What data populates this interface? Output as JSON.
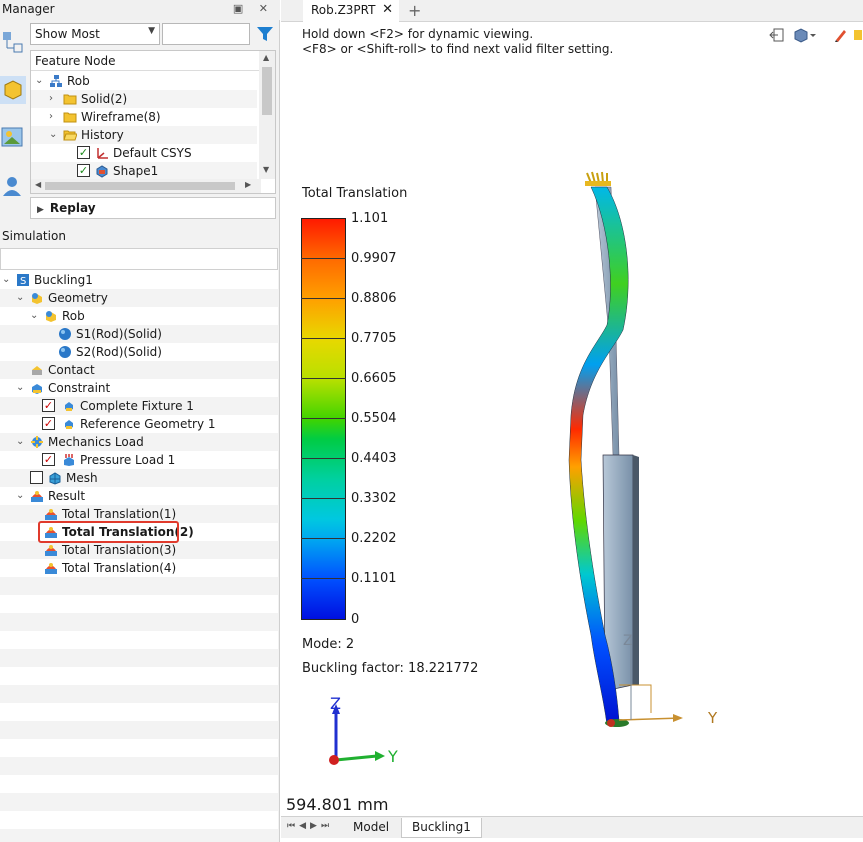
{
  "manager": {
    "title": "Manager",
    "show_filter": "Show Most",
    "filter_input": "",
    "tree_header": "Feature Node",
    "tree_items": [
      {
        "label": "Rob",
        "level": 0
      },
      {
        "label": "Solid(2)",
        "level": 1
      },
      {
        "label": "Wireframe(8)",
        "level": 1
      },
      {
        "label": "History",
        "level": 1
      },
      {
        "label": "Default CSYS",
        "level": 2
      },
      {
        "label": "Shape1",
        "level": 2
      }
    ],
    "replay": "Replay"
  },
  "simulation": {
    "title": "Simulation",
    "items": [
      {
        "label": "Buckling1"
      },
      {
        "label": "Geometry"
      },
      {
        "label": "Rob"
      },
      {
        "label": "S1(Rod)(Solid)"
      },
      {
        "label": "S2(Rod)(Solid)"
      },
      {
        "label": "Contact"
      },
      {
        "label": "Constraint"
      },
      {
        "label": "Complete Fixture 1"
      },
      {
        "label": "Reference Geometry 1"
      },
      {
        "label": "Mechanics Load"
      },
      {
        "label": "Pressure Load 1"
      },
      {
        "label": "Mesh"
      },
      {
        "label": "Result"
      },
      {
        "label": "Total Translation(1)"
      },
      {
        "label": "Total Translation(2)"
      },
      {
        "label": "Total Translation(3)"
      },
      {
        "label": "Total Translation(4)"
      }
    ]
  },
  "document": {
    "tab": "Rob.Z3PRT",
    "hint_line1": "Hold down <F2> for dynamic viewing.",
    "hint_line2": "<F8> or <Shift-roll> to find next valid filter setting.",
    "legend_title": "Total Translation",
    "legend_values": [
      "1.101",
      "0.9907",
      "0.8806",
      "0.7705",
      "0.6605",
      "0.5504",
      "0.4403",
      "0.3302",
      "0.2202",
      "0.1101",
      "0"
    ],
    "mode": "Mode: 2",
    "buckling_factor": "Buckling factor: 18.221772",
    "distance": "594.801 mm",
    "axis_z": "Z",
    "axis_y": "Y",
    "bottom_tabs": [
      "Model",
      "Buckling1"
    ]
  }
}
